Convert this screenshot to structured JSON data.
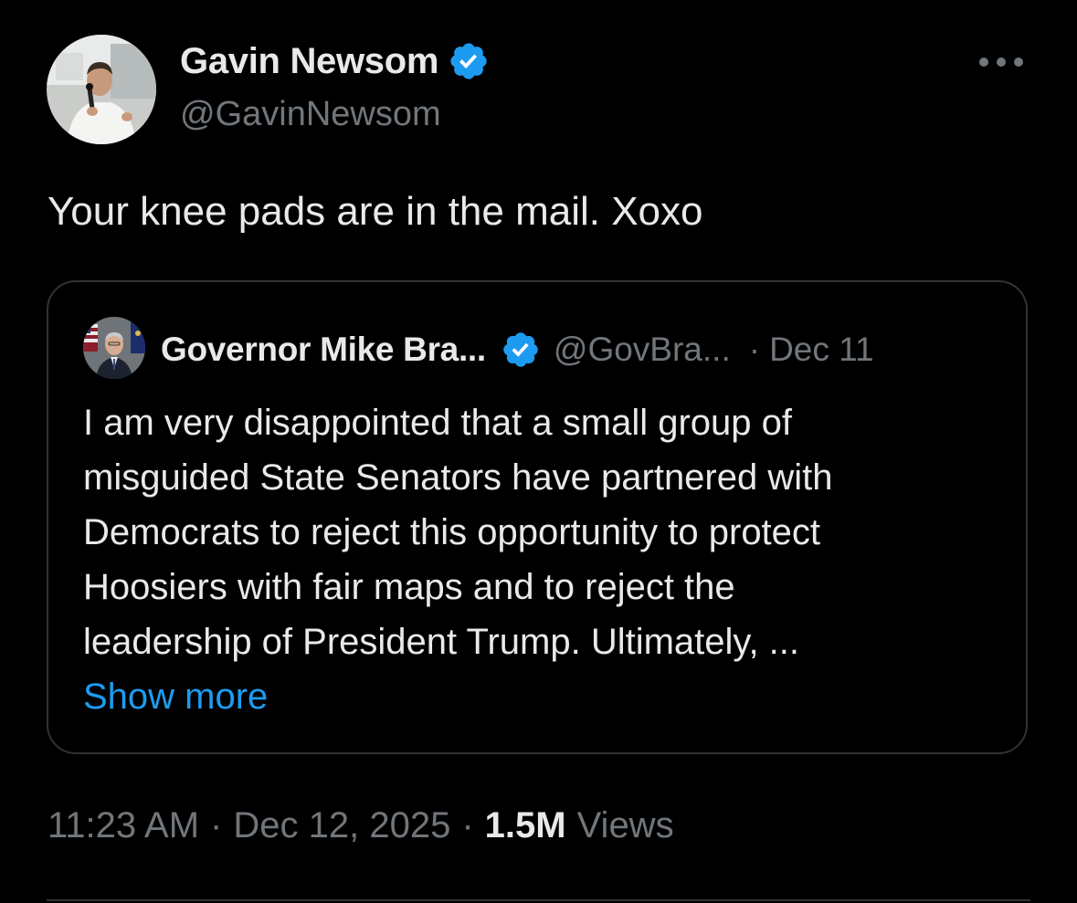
{
  "colors": {
    "background": "#000000",
    "primary_text": "#e7e9ea",
    "secondary_text": "#71767b",
    "accent": "#1d9bf0",
    "border": "#2f3336"
  },
  "tweet": {
    "author": {
      "name": "Gavin Newsom",
      "handle": "@GavinNewsom",
      "verified": true,
      "avatar_icon": "profile-photo"
    },
    "more_icon": "ellipsis-icon",
    "text": "Your knee pads are in the mail. Xoxo",
    "quote": {
      "author_name": "Governor Mike Bra...",
      "handle": "@GovBra...",
      "separator": "·",
      "date": "Dec 11",
      "verified": true,
      "lines": [
        "I am very disappointed that a small group of",
        "misguided State Senators have partnered with",
        "Democrats to reject this opportunity to protect",
        "Hoosiers with fair maps and to reject the",
        "leadership of President Trump. Ultimately, ..."
      ],
      "show_more": "Show more"
    },
    "meta": {
      "time": "11:23 AM",
      "sep1": "·",
      "date": "Dec 12, 2025",
      "sep2": "·",
      "views_count": "1.5M",
      "views_label": "Views"
    }
  }
}
